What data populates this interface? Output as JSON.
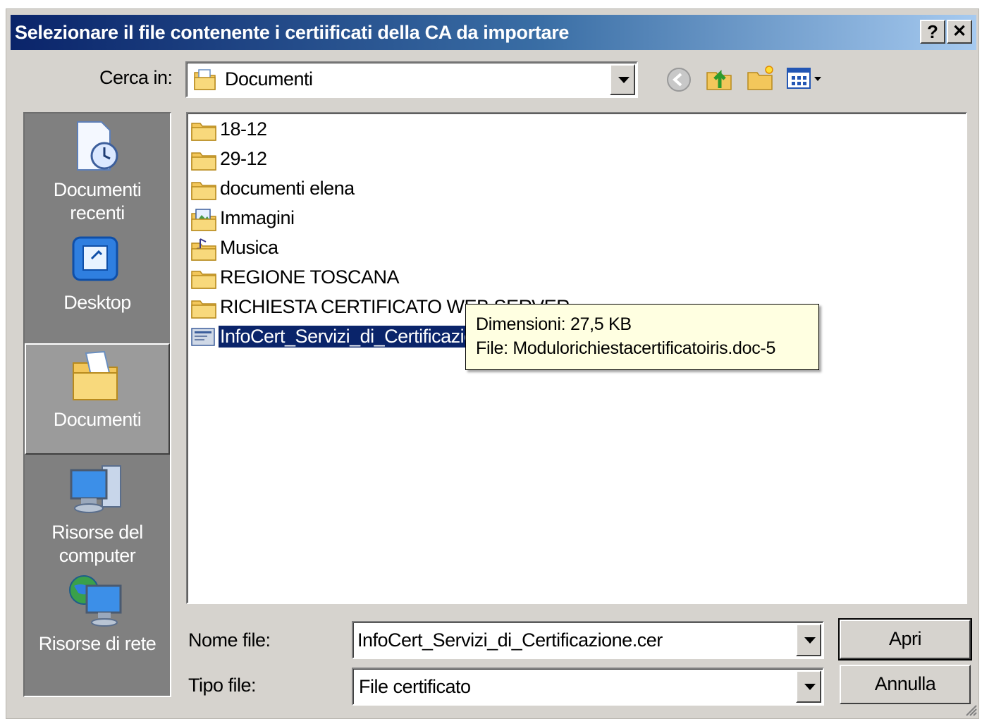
{
  "window": {
    "title": "Selezionare il file contenente i certiificati della CA da importare",
    "help_button": "?",
    "close_button": "✕"
  },
  "lookin": {
    "label": "Cerca in:",
    "value": "Documenti"
  },
  "toolbar": {
    "back_icon": "back-arrow-icon",
    "up_icon": "up-folder-icon",
    "new_folder_icon": "new-folder-icon",
    "view_menu_icon": "view-menu-icon"
  },
  "places": [
    {
      "label": "Documenti recenti",
      "icon": "recent-documents-icon"
    },
    {
      "label": "Desktop",
      "icon": "desktop-icon"
    },
    {
      "label": "Documenti",
      "icon": "my-documents-icon",
      "selected": true
    },
    {
      "label": "Risorse del computer",
      "icon": "my-computer-icon"
    },
    {
      "label": "Risorse di rete",
      "icon": "network-places-icon"
    }
  ],
  "files": [
    {
      "name": "18-12",
      "icon": "folder-icon"
    },
    {
      "name": "29-12",
      "icon": "folder-icon"
    },
    {
      "name": "documenti elena",
      "icon": "folder-icon"
    },
    {
      "name": "Immagini",
      "icon": "pictures-folder-icon"
    },
    {
      "name": "Musica",
      "icon": "music-folder-icon"
    },
    {
      "name": "REGIONE TOSCANA",
      "icon": "folder-icon"
    },
    {
      "name": "RICHIESTA CERTIFICATO WEB SERVER",
      "icon": "folder-icon"
    },
    {
      "name": "InfoCert_Servizi_di_Certificazione",
      "icon": "certificate-file-icon",
      "selected": true
    }
  ],
  "tooltip": {
    "line1": "Dimensioni: 27,5 KB",
    "line2": "File: Modulorichiestacertificatoiris.doc-5"
  },
  "filename": {
    "label": "Nome file:",
    "value": "InfoCert_Servizi_di_Certificazione.cer"
  },
  "filetype": {
    "label": "Tipo file:",
    "value": "File certificato"
  },
  "buttons": {
    "open": "Apri",
    "cancel": "Annulla"
  }
}
